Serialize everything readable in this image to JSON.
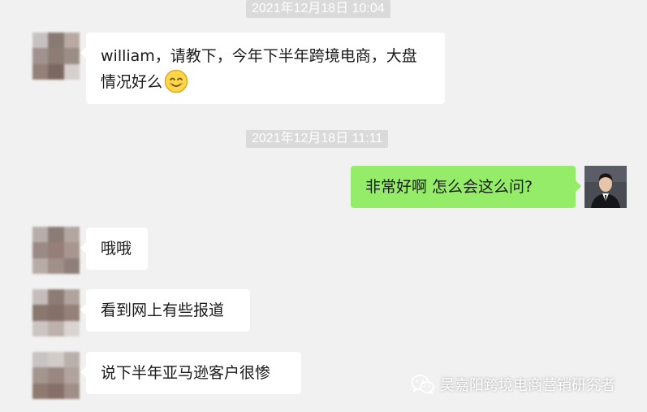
{
  "timestamps": [
    "2021年12月18日 10:04",
    "2021年12月18日 11:11"
  ],
  "messages": [
    {
      "side": "left",
      "text": "william，请教下，今年下半年跨境电商，大盘情况好么",
      "emoji": "smiling-face-icon"
    },
    {
      "side": "right",
      "text": "非常好啊  怎么会这么问?"
    },
    {
      "side": "left",
      "text": "哦哦"
    },
    {
      "side": "left",
      "text": "看到网上有些报道"
    },
    {
      "side": "left",
      "text": "说下半年亚马逊客户很惨"
    }
  ],
  "watermark": {
    "text": "吴嘉阳跨境电商营销研究者",
    "icon": "wechat-icon"
  },
  "colors": {
    "background": "#f1f1f1",
    "timestamp_bg": "#dadada",
    "bubble_left": "#ffffff",
    "bubble_right": "#95ec69"
  }
}
